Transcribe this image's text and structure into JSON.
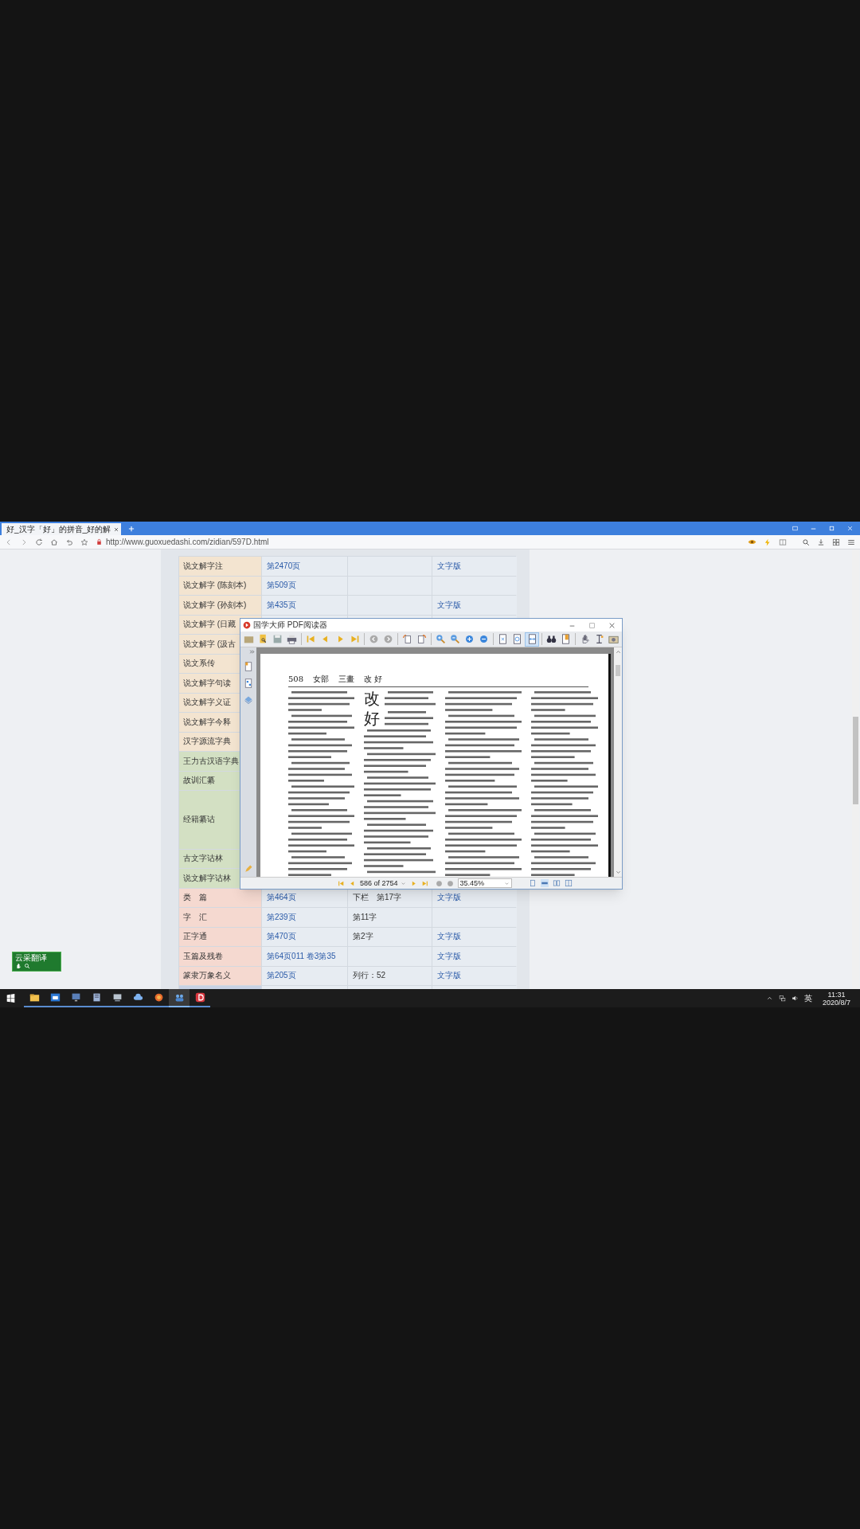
{
  "browser": {
    "tab_title": "好_汉字「好」的拼音_好的解",
    "url": "http://www.guoxuedashi.com/zidian/597D.html"
  },
  "table": {
    "rows": [
      {
        "label": "说文解字注",
        "page": "第2470页",
        "edition": "文字版",
        "color": "#f3e4d0",
        "kind": "normal"
      },
      {
        "label": "说文解字 (陈刻本)",
        "page": "第509页",
        "color": "#f3e4d0",
        "kind": "normal"
      },
      {
        "label": "说文解字 (孙刻本)",
        "page": "第435页",
        "edition": "文字版",
        "color": "#f3e4d0",
        "kind": "normal"
      },
      {
        "label": "说文解字 (日藏",
        "color": "#f3e4d0",
        "kind": "normal"
      },
      {
        "label": "说文解字 (汲古",
        "color": "#f3e4d0",
        "kind": "normal"
      },
      {
        "label": "说文系传",
        "color": "#f3e4d0",
        "kind": "normal"
      },
      {
        "label": "说文解字句读",
        "color": "#f3e4d0",
        "kind": "normal"
      },
      {
        "label": "说文解字义证",
        "color": "#f3e4d0",
        "kind": "normal"
      },
      {
        "label": "说文解字今释",
        "color": "#f3e4d0",
        "kind": "normal"
      },
      {
        "label": "汉字源流字典",
        "color": "#f3e4d0",
        "kind": "normal"
      },
      {
        "label": "王力古汉语字典",
        "color": "#d3e0c3",
        "kind": "normal"
      },
      {
        "label": "故训汇纂",
        "color": "#d3e0c3",
        "kind": "normal"
      },
      {
        "label": "经籍纂诂",
        "color": "#d3e0c3",
        "kind": "tall"
      },
      {
        "label": "古文字诂林",
        "color": "#d3e0c3",
        "kind": "normal"
      },
      {
        "label": "说文解字诂林",
        "color": "#d3e0c3",
        "kind": "normal"
      },
      {
        "label": "类　篇",
        "page": "第464页",
        "note": "下栏　第17字",
        "edition": "文字版",
        "color": "#f5d9d0",
        "kind": "normal"
      },
      {
        "label": "字　汇",
        "page": "第239页",
        "note": "第11字",
        "color": "#f5d9d0",
        "kind": "normal"
      },
      {
        "label": "正字通",
        "page": "第470页",
        "note": "第2字",
        "edition": "文字版",
        "color": "#f5d9d0",
        "kind": "normal"
      },
      {
        "label": "玉篇及残卷",
        "page": "第64页011 卷3第35",
        "edition": "文字版",
        "color": "#f5d9d0",
        "kind": "normal"
      },
      {
        "label": "篆隶万象名义",
        "page": "第205页",
        "note": "列行：52",
        "edition": "文字版",
        "color": "#f5d9d0",
        "kind": "normal"
      },
      {
        "color": "#c8d2e4",
        "kind": "partial"
      }
    ]
  },
  "pdf_viewer": {
    "title": "国学大师 PDF阅读器",
    "page_header": [
      "508",
      "女部",
      "三畫",
      "改 好"
    ],
    "headwords": [
      "改",
      "好"
    ],
    "page_field": "586 of 2754",
    "zoom_field": "35.45%"
  },
  "translate_widget": {
    "label": "云采翻译"
  },
  "taskbar": {
    "input_method": "英",
    "time": "11:31",
    "date": "2020/8/7"
  }
}
